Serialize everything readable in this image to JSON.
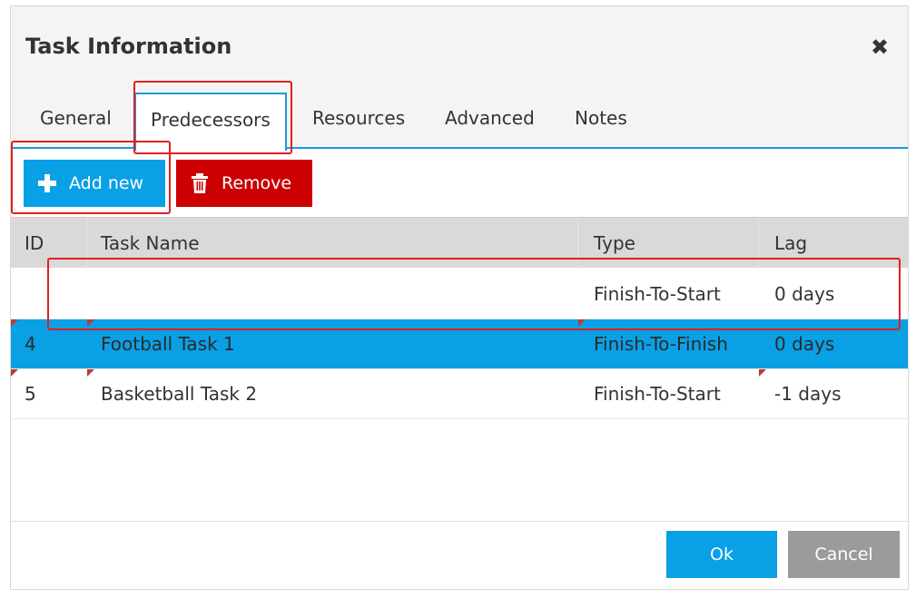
{
  "dialog": {
    "title": "Task Information",
    "close_icon": "close-icon"
  },
  "tabs": [
    {
      "label": "General"
    },
    {
      "label": "Predecessors",
      "active": true
    },
    {
      "label": "Resources"
    },
    {
      "label": "Advanced"
    },
    {
      "label": "Notes"
    }
  ],
  "toolbar": {
    "add_label": "Add new",
    "add_icon": "plus-icon",
    "remove_label": "Remove",
    "remove_icon": "trash-icon"
  },
  "grid": {
    "columns": [
      "ID",
      "Task Name",
      "Type",
      "Lag"
    ],
    "rows": [
      {
        "id": "",
        "name": "",
        "type": "Finish-To-Start",
        "lag": "0 days"
      },
      {
        "id": "4",
        "name": "Football Task 1",
        "type": "Finish-To-Finish",
        "lag": "0 days",
        "selected": true
      },
      {
        "id": "5",
        "name": "Basketball Task 2",
        "type": "Finish-To-Start",
        "lag": "-1 days"
      }
    ]
  },
  "footer": {
    "ok_label": "Ok",
    "cancel_label": "Cancel"
  },
  "colors": {
    "accent": "#0aa0e6",
    "danger": "#cc0000",
    "highlight": "#e02020",
    "cancel": "#9b9b9b"
  }
}
